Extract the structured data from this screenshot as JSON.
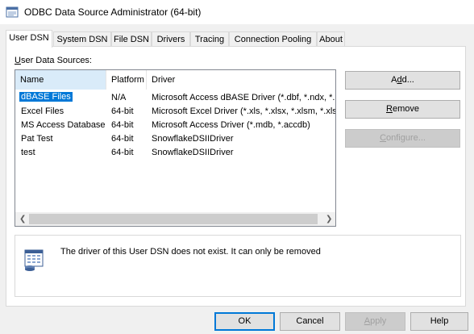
{
  "window": {
    "title": "ODBC Data Source Administrator (64-bit)"
  },
  "tabs": [
    {
      "label": "User DSN",
      "active": true
    },
    {
      "label": "System DSN"
    },
    {
      "label": "File DSN"
    },
    {
      "label": "Drivers"
    },
    {
      "label": "Tracing"
    },
    {
      "label": "Connection Pooling"
    },
    {
      "label": "About"
    }
  ],
  "user_dsn": {
    "group_label_pre": "",
    "group_label_u": "U",
    "group_label_post": "ser Data Sources:",
    "columns": [
      "Name",
      "Platform",
      "Driver"
    ],
    "rows": [
      {
        "name": "dBASE Files",
        "platform": "N/A",
        "driver": "Microsoft Access dBASE Driver (*.dbf, *.ndx, *.m",
        "selected": true
      },
      {
        "name": "Excel Files",
        "platform": "64-bit",
        "driver": "Microsoft Excel Driver (*.xls, *.xlsx, *.xlsm, *.xlsb)"
      },
      {
        "name": "MS Access Database",
        "platform": "64-bit",
        "driver": "Microsoft Access Driver (*.mdb, *.accdb)"
      },
      {
        "name": "Pat Test",
        "platform": "64-bit",
        "driver": "SnowflakeDSIIDriver"
      },
      {
        "name": "test",
        "platform": "64-bit",
        "driver": "SnowflakeDSIIDriver"
      }
    ],
    "buttons": {
      "add": {
        "pre": "A",
        "u": "d",
        "post": "d..."
      },
      "remove": {
        "pre": "",
        "u": "R",
        "post": "emove"
      },
      "configure": {
        "pre": "",
        "u": "C",
        "post": "onfigure...",
        "disabled": true
      }
    },
    "info_text": "The driver of this User DSN does not exist. It can only be removed"
  },
  "footer_buttons": {
    "ok": "OK",
    "cancel": "Cancel",
    "apply": {
      "pre": "",
      "u": "A",
      "post": "pply",
      "disabled": true
    },
    "help": "Help"
  },
  "colors": {
    "selection": "#0078d7",
    "sorted_header": "#d9ebf9"
  }
}
